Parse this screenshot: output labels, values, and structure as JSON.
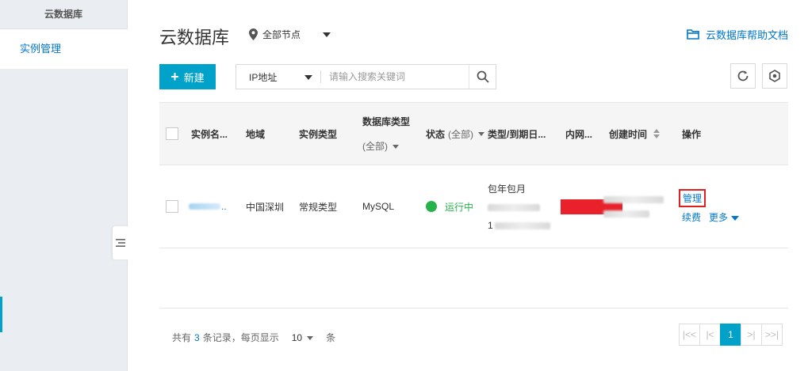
{
  "sidebar": {
    "header": "云数据库",
    "items": [
      {
        "label": "实例管理"
      }
    ]
  },
  "header": {
    "title": "云数据库",
    "region": "全部节点",
    "help_link": "云数据库帮助文档"
  },
  "toolbar": {
    "new_button": "新建",
    "search_filter": "IP地址",
    "search_placeholder": "请输入搜索关键词"
  },
  "table": {
    "columns": {
      "name": "实例名...",
      "region": "地域",
      "instance_type": "实例类型",
      "db_type": "数据库类型",
      "db_type_filter": "(全部)",
      "status": "状态",
      "status_filter": "(全部)",
      "billing": "类型/到期日...",
      "intranet": "内网...",
      "created": "创建时间",
      "actions": "操作"
    },
    "rows": [
      {
        "name_suffix": "..",
        "region": "中国深圳",
        "instance_type": "常规类型",
        "db_type": "MySQL",
        "status": "运行中",
        "billing_type": "包年包月",
        "expiry_prefix": "1",
        "actions": {
          "manage": "管理",
          "renew": "续费",
          "more": "更多"
        }
      }
    ]
  },
  "pagination": {
    "prefix": "共有",
    "total": "3",
    "suffix": "条记录，每页显示",
    "page_size": "10",
    "unit": "条",
    "current_page": "1"
  },
  "colors": {
    "accent": "#00a2ca",
    "link": "#0077cc",
    "running": "#27b34a",
    "highlight": "#e02020"
  }
}
